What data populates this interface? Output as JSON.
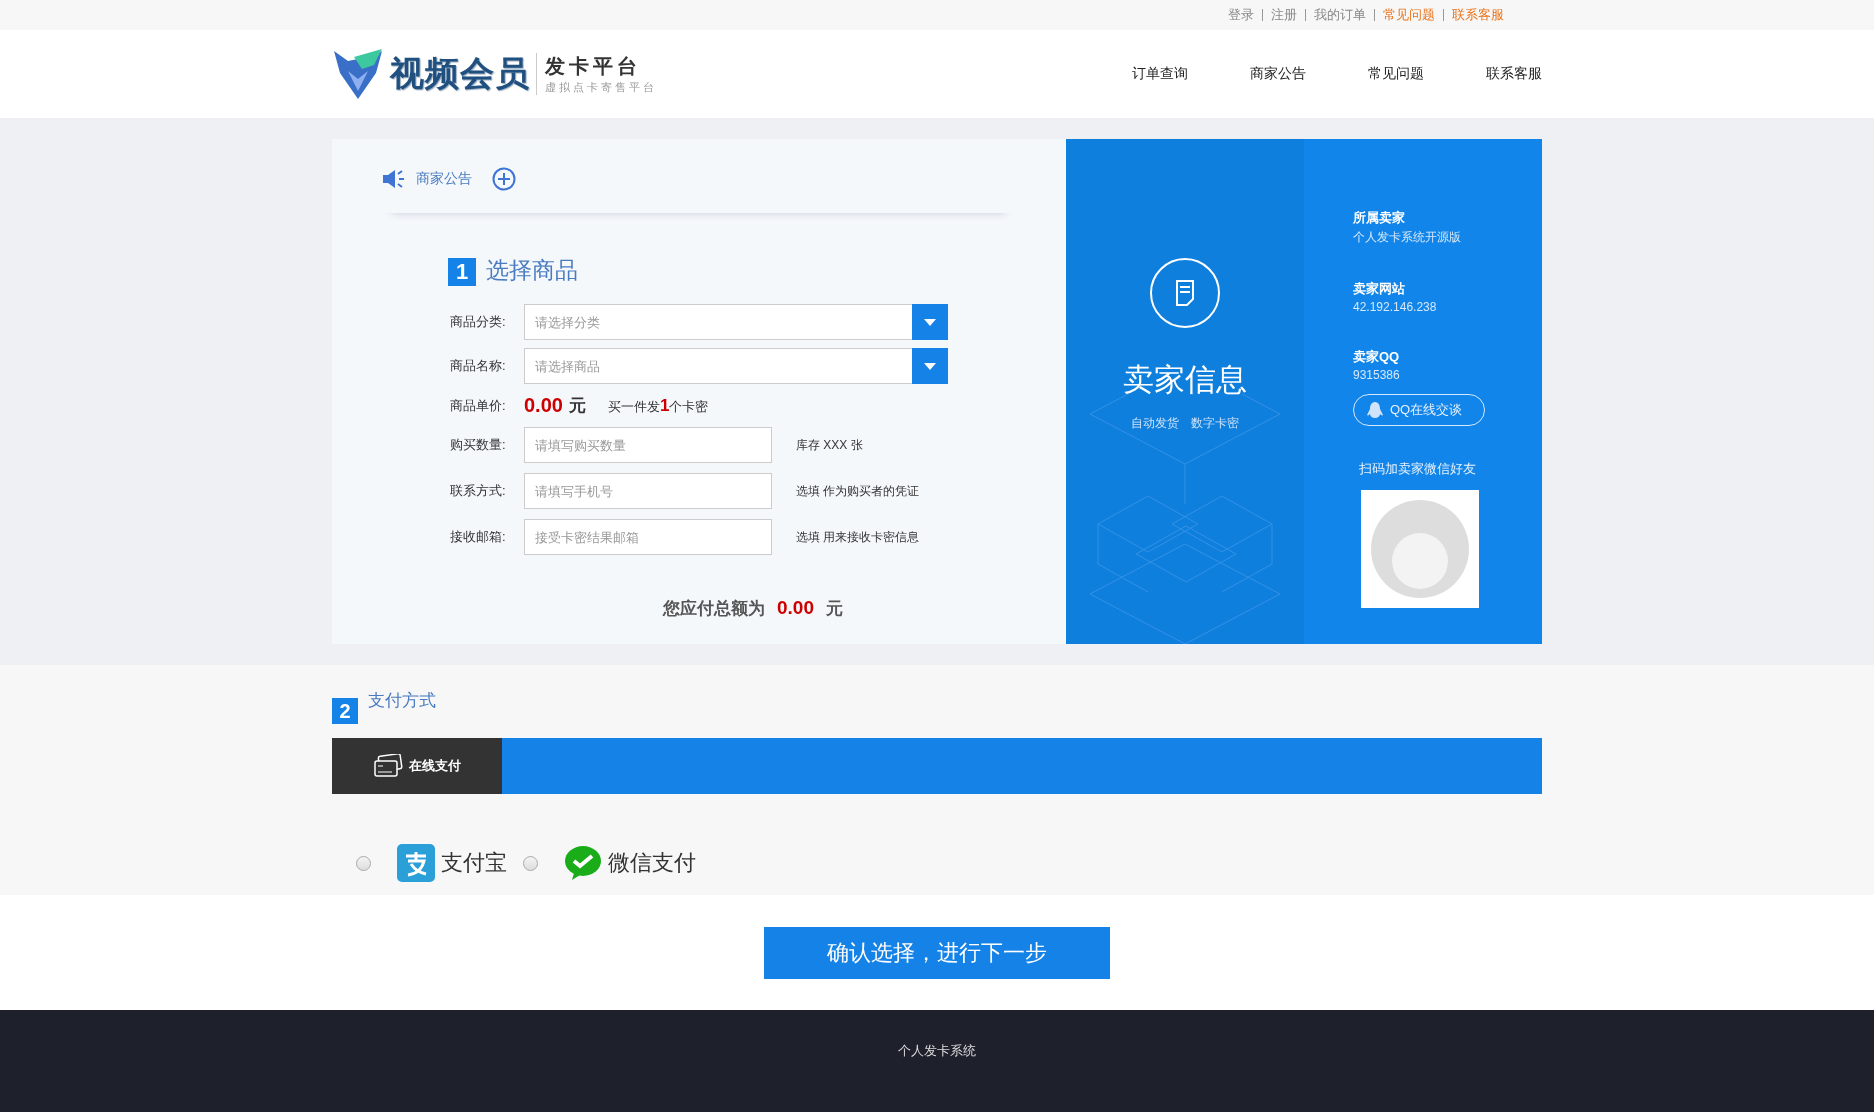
{
  "top_links": [
    {
      "label": "登录",
      "highlighted": false
    },
    {
      "label": "注册",
      "highlighted": false
    },
    {
      "label": "我的订单",
      "highlighted": false
    },
    {
      "label": "常见问题",
      "highlighted": true
    },
    {
      "label": "联系客服",
      "highlighted": true
    }
  ],
  "logo": {
    "title": "视频会员",
    "subtitle": "发卡平台",
    "tagline": "虚拟点卡寄售平台"
  },
  "nav": [
    "订单查询",
    "商家公告",
    "常见问题",
    "联系客服"
  ],
  "notice": {
    "label": "商家公告"
  },
  "step1": {
    "number": "1",
    "title": "选择商品",
    "selects": [
      {
        "label": "商品分类:",
        "placeholder": "请选择分类"
      },
      {
        "label": "商品名称:",
        "placeholder": "请选择商品"
      }
    ],
    "price": {
      "label": "商品单价:",
      "value": "0.00",
      "unit": "元",
      "note_prefix": "买一件发",
      "note_count": "1",
      "note_suffix": "个卡密"
    },
    "inputs": [
      {
        "label": "购买数量:",
        "placeholder": "请填写购买数量",
        "hint": "库存 XXX 张"
      },
      {
        "label": "联系方式:",
        "placeholder": "请填写手机号",
        "hint": "选填 作为购买者的凭证"
      },
      {
        "label": "接收邮箱:",
        "placeholder": "接受卡密结果邮箱",
        "hint": "选填 用来接收卡密信息"
      }
    ],
    "total": {
      "label": "您应付总额为",
      "value": "0.00",
      "unit": "元"
    }
  },
  "seller": {
    "title": "卖家信息",
    "tags": [
      "自动发货",
      "数字卡密"
    ],
    "fields": [
      {
        "label": "所属卖家",
        "value": "个人发卡系统开源版"
      },
      {
        "label": "卖家网站",
        "value": "42.192.146.238"
      },
      {
        "label": "卖家QQ",
        "value": "9315386"
      }
    ],
    "qq_button": "QQ在线交谈",
    "qr_caption": "扫码加卖家微信好友"
  },
  "step2": {
    "number": "2",
    "title": "支付方式",
    "tabs": [
      {
        "label": "在线支付",
        "selected": true
      }
    ],
    "methods": [
      {
        "kind": "alipay",
        "label": "支付宝",
        "selected": false
      },
      {
        "kind": "wechat",
        "label": "微信支付",
        "selected": false
      }
    ]
  },
  "confirm_button": "确认选择，进行下一步",
  "footer": "个人发卡系统"
}
